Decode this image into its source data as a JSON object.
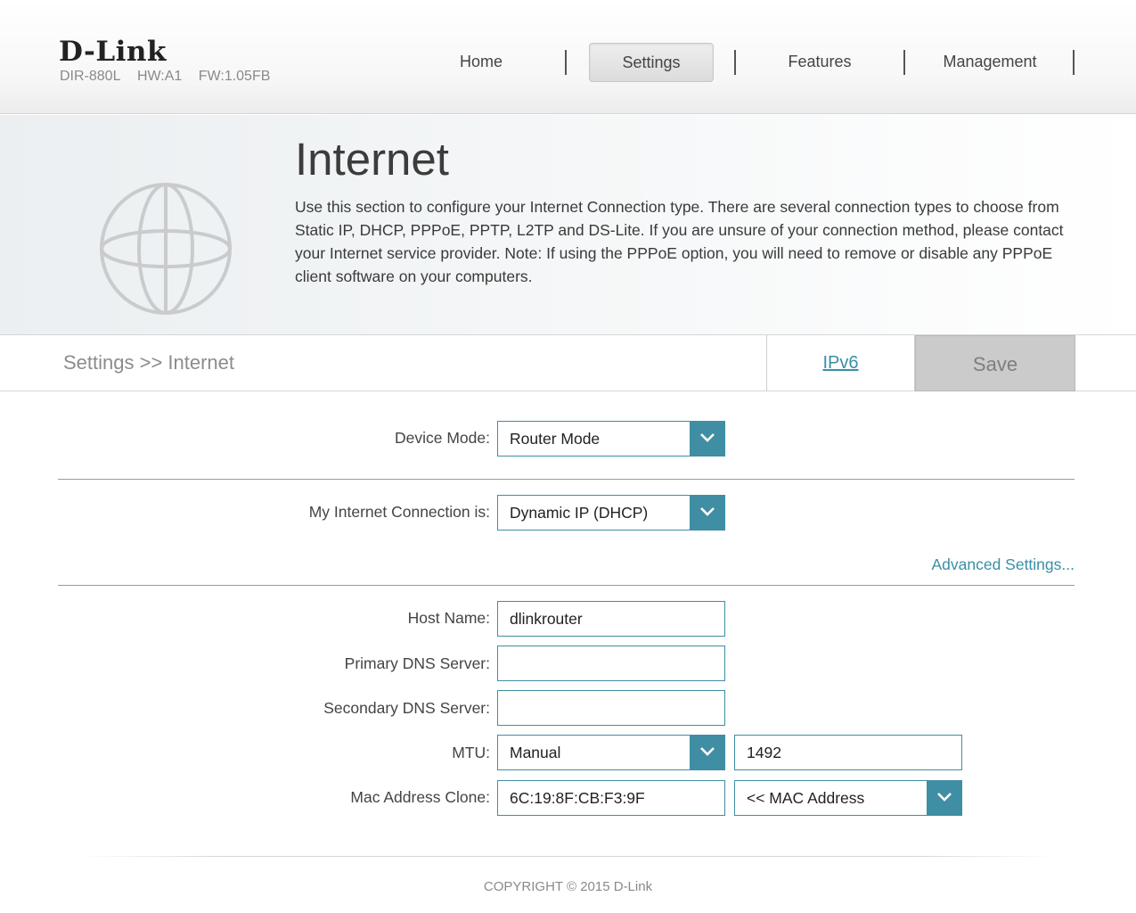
{
  "brand": {
    "logo": "D-Link",
    "model": "DIR-880L",
    "hw": "HW:A1",
    "fw": "FW:1.05FB"
  },
  "nav": {
    "home": "Home",
    "settings": "Settings",
    "features": "Features",
    "management": "Management"
  },
  "banner": {
    "title": "Internet",
    "description": "Use this section to configure your Internet Connection type. There are several connection types to choose from Static IP, DHCP, PPPoE, PPTP, L2TP and DS-Lite. If you are unsure of your connection method, please contact your Internet service provider. Note: If using the PPPoE option, you will need to remove or disable any PPPoE client software on your computers.",
    "icon": "globe-icon"
  },
  "subbar": {
    "breadcrumb": "Settings >> Internet",
    "ipv6": "IPv6",
    "save": "Save"
  },
  "form": {
    "device_mode": {
      "label": "Device Mode:",
      "value": "Router Mode"
    },
    "connection": {
      "label": "My Internet Connection is:",
      "value": "Dynamic IP (DHCP)"
    },
    "advanced": "Advanced Settings...",
    "host_name": {
      "label": "Host Name:",
      "value": "dlinkrouter"
    },
    "primary_dns": {
      "label": "Primary DNS Server:",
      "value": ""
    },
    "secondary_dns": {
      "label": "Secondary DNS Server:",
      "value": ""
    },
    "mtu": {
      "label": "MTU:",
      "mode": "Manual",
      "value": "1492"
    },
    "mac_clone": {
      "label": "Mac Address Clone:",
      "value": "6C:19:8F:CB:F3:9F",
      "select": "<< MAC Address"
    }
  },
  "footer": {
    "copyright": "COPYRIGHT © 2015 D-Link"
  },
  "colors": {
    "accent": "#3f8ea3",
    "link": "#3a8fa6",
    "save_bg": "#cbcbcb"
  }
}
